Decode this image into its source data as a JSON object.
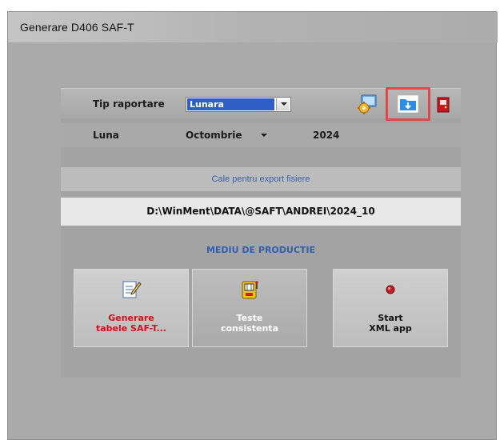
{
  "window": {
    "title": "Generare D406 SAF-T"
  },
  "row_tip": {
    "label": "Tip raportare",
    "combo_value": "Lunara"
  },
  "row_luna": {
    "label": "Luna",
    "month_value": "Octombrie",
    "year_value": "2024"
  },
  "export_path": {
    "caption": "Cale pentru export fisiere",
    "path": "D:\\WinMent\\DATA\\@SAFT\\ANDREI\\2024_10"
  },
  "environment": {
    "label": "MEDIU DE PRODUCTIE"
  },
  "tiles": [
    {
      "line1": "Generare",
      "line2": "tabele SAF-T...",
      "icon": "edit-document-icon"
    },
    {
      "line1": "Teste",
      "line2": "consistenta",
      "icon": "slot-machine-icon"
    },
    {
      "line1": "Start",
      "line2": "XML app",
      "icon": "red-dot-icon"
    }
  ],
  "toolbar_icons": [
    "settings-gear-icon",
    "folder-download-icon",
    "exit-door-icon"
  ],
  "colors": {
    "highlight_border": "#e0474d",
    "selection_blue": "#2d5fc7",
    "caption_blue": "#3a62a8",
    "generate_red": "#d0101a",
    "tile_white_text": "#ffffff",
    "tile_dark_text": "#111111"
  }
}
